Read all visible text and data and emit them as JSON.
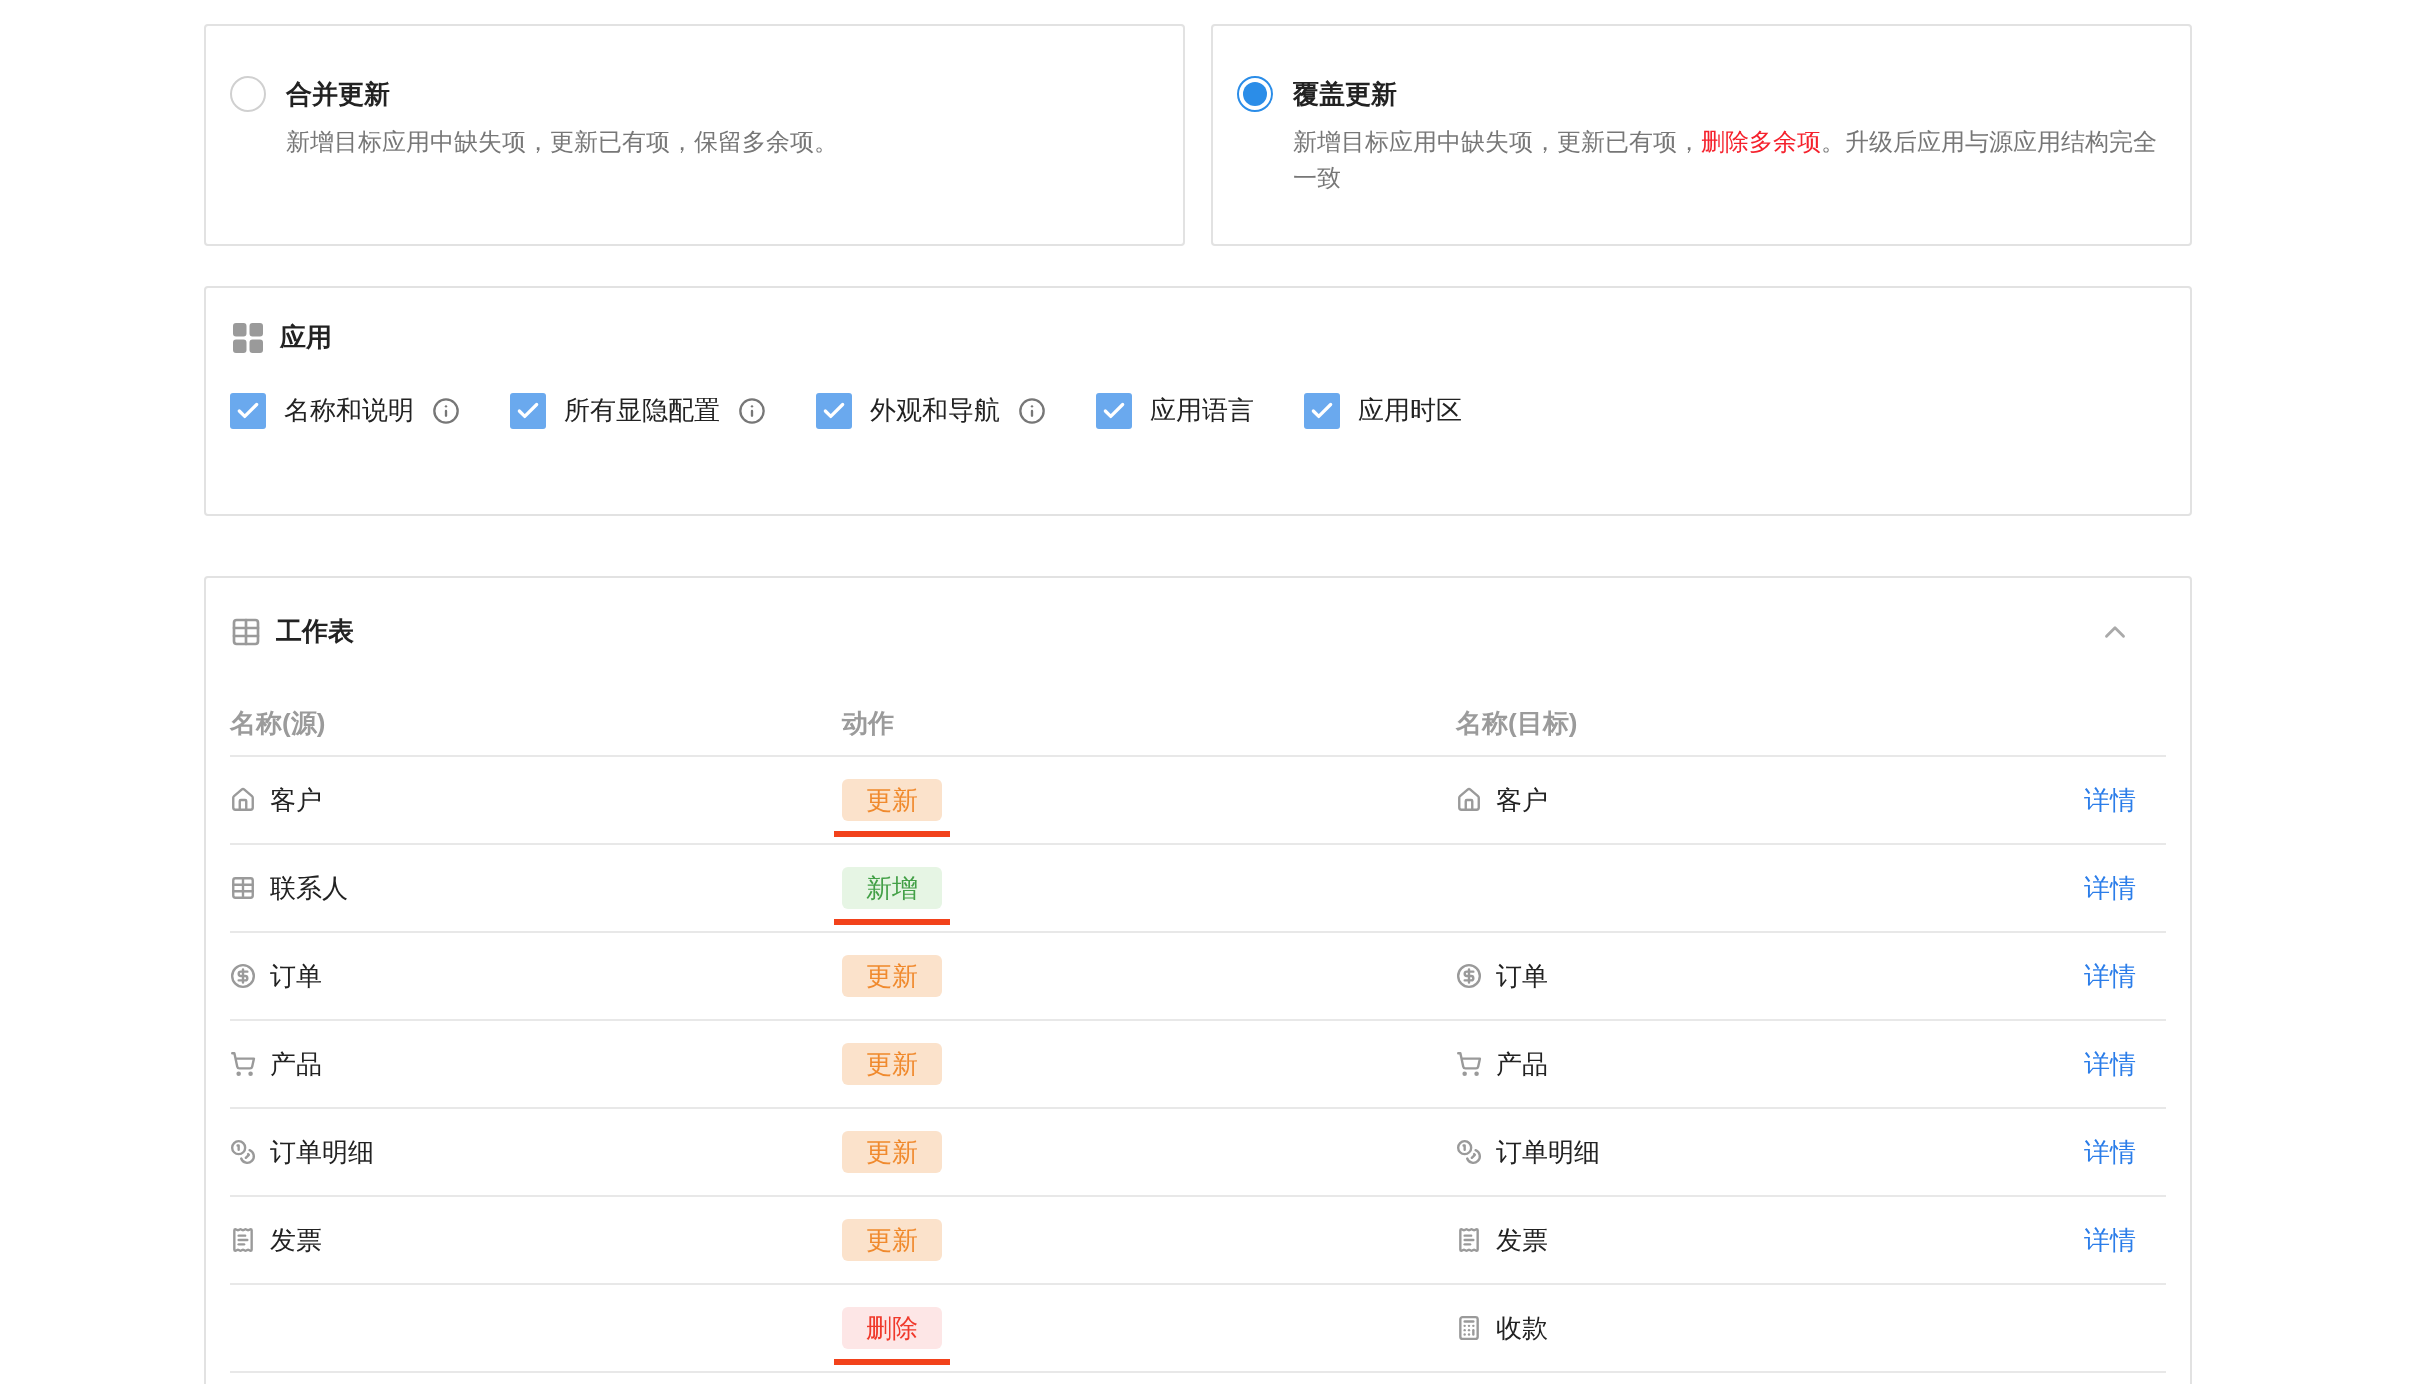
{
  "merge_options": [
    {
      "title": "合并更新",
      "selected": false,
      "description": [
        {
          "text": "新增目标应用中缺失项，更新已有项，保留多余项。",
          "kind": "normal"
        }
      ]
    },
    {
      "title": "覆盖更新",
      "selected": true,
      "description": [
        {
          "text": "新增目标应用中缺失项，更新已有项，",
          "kind": "normal"
        },
        {
          "text": "删除多余项",
          "kind": "warning"
        },
        {
          "text": "。升级后应用与源应用结构完全一致",
          "kind": "normal"
        }
      ]
    }
  ],
  "app_section": {
    "title": "应用",
    "options": [
      {
        "label": "名称和说明",
        "checked": true,
        "info": true
      },
      {
        "label": "所有显隐配置",
        "checked": true,
        "info": true
      },
      {
        "label": "外观和导航",
        "checked": true,
        "info": true
      },
      {
        "label": "应用语言",
        "checked": true,
        "info": false
      },
      {
        "label": "应用时区",
        "checked": true,
        "info": false
      }
    ]
  },
  "worksheets": {
    "title": "工作表",
    "expanded": true,
    "columns": [
      "名称(源)",
      "动作",
      "名称(目标)"
    ],
    "rows": [
      {
        "source": "客户",
        "action": {
          "label": "更新",
          "kind": "update"
        },
        "underlined": true,
        "target": "客户",
        "detail": "详情"
      },
      {
        "source": "联系人",
        "action": {
          "label": "新增",
          "kind": "add"
        },
        "underlined": true,
        "detail": "详情"
      },
      {
        "source": "订单",
        "action": {
          "label": "更新",
          "kind": "update"
        },
        "underlined": false,
        "target": "订单",
        "detail": "详情"
      },
      {
        "source": "产品",
        "action": {
          "label": "更新",
          "kind": "update"
        },
        "underlined": false,
        "target": "产品",
        "detail": "详情"
      },
      {
        "source": "订单明细",
        "action": {
          "label": "更新",
          "kind": "update"
        },
        "underlined": false,
        "target": "订单明细",
        "detail": "详情"
      },
      {
        "source": "发票",
        "action": {
          "label": "更新",
          "kind": "update"
        },
        "underlined": false,
        "target": "发票",
        "detail": "详情"
      },
      {
        "action": {
          "label": "删除",
          "kind": "delete"
        },
        "underlined": true,
        "target": "收款"
      }
    ]
  }
}
